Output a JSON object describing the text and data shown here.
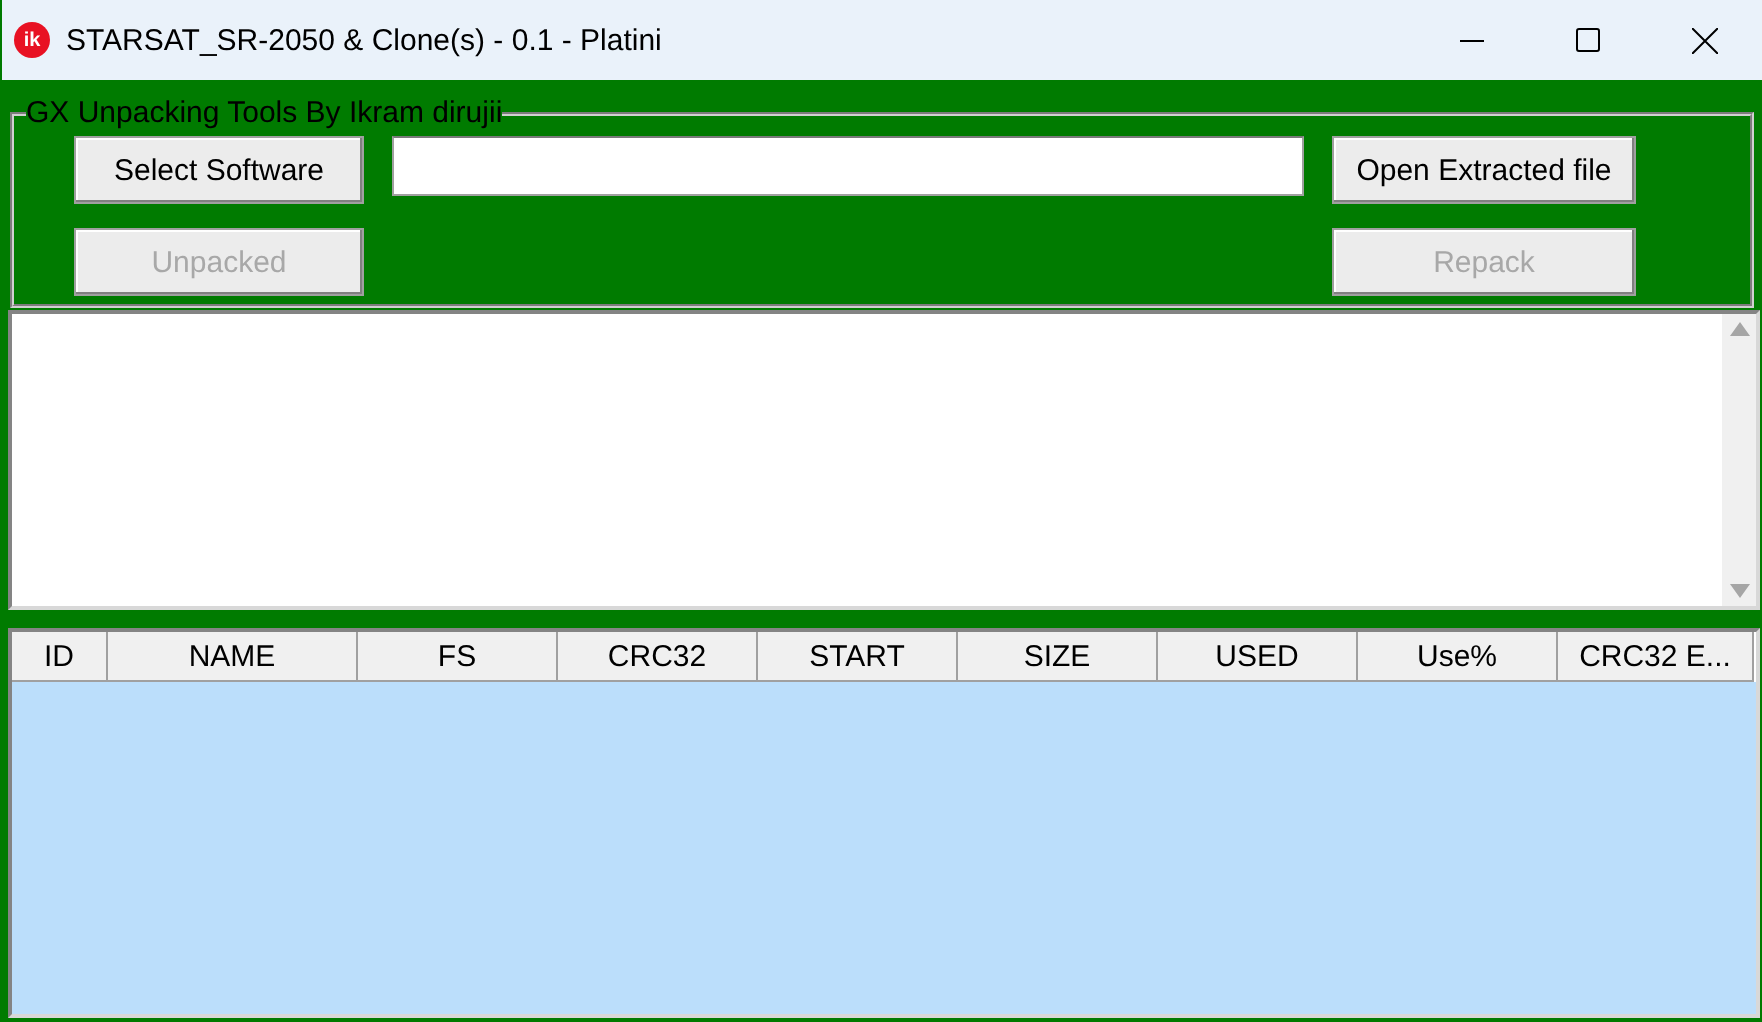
{
  "window": {
    "title": "STARSAT_SR-2050 & Clone(s) - 0.1 - Platini",
    "app_icon_text": "ik"
  },
  "group": {
    "title": "GX Unpacking Tools By Ikram dirujii"
  },
  "buttons": [
    {
      "label": "Select Software",
      "disabled": false
    },
    {
      "label": "Open Extracted file",
      "disabled": false
    },
    {
      "label": "Unpacked",
      "disabled": true
    },
    {
      "label": "Repack",
      "disabled": true
    }
  ],
  "table": {
    "columns": [
      "ID",
      "NAME",
      "FS",
      "CRC32",
      "START",
      "SIZE",
      "USED",
      "Use%",
      "CRC32 E..."
    ]
  }
}
